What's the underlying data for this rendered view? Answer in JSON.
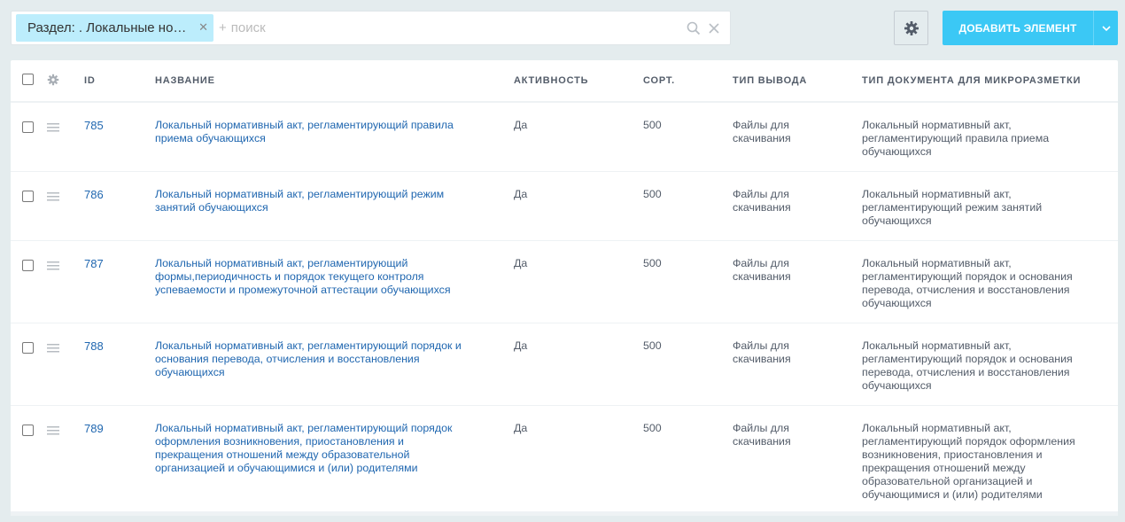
{
  "filter": {
    "chip_label": "Раздел: . Локальные но…",
    "plus": "+",
    "search_placeholder": "поиск"
  },
  "toolbar": {
    "add_label": "ДОБАВИТЬ ЭЛЕМЕНТ"
  },
  "table": {
    "headers": {
      "id": "ID",
      "name": "НАЗВАНИЕ",
      "active": "АКТИВНОСТЬ",
      "sort": "СОРТ.",
      "type": "ТИП ВЫВОДА",
      "doctype": "ТИП ДОКУМЕНТА ДЛЯ МИКРОРАЗМЕТКИ"
    },
    "rows": [
      {
        "id": "785",
        "name": "Локальный нормативный акт, регламентирующий правила приема обучающихся",
        "active": "Да",
        "sort": "500",
        "type": "Файлы для скачивания",
        "doctype": "Локальный нормативный акт, регламентирующий правила приема обучающихся"
      },
      {
        "id": "786",
        "name": "Локальный нормативный акт, регламентирующий режим занятий обучающихся",
        "active": "Да",
        "sort": "500",
        "type": "Файлы для скачивания",
        "doctype": "Локальный нормативный акт, регламентирующий режим занятий обучающихся"
      },
      {
        "id": "787",
        "name": "Локальный нормативный акт, регламентирующий формы,периодичность и порядок текущего контроля успеваемости и промежуточной аттестации обучающихся",
        "active": "Да",
        "sort": "500",
        "type": "Файлы для скачивания",
        "doctype": "Локальный нормативный акт, регламентирующий порядок и основания перевода, отчисления и восстановления обучающихся"
      },
      {
        "id": "788",
        "name": "Локальный нормативный акт, регламентирующий порядок и основания перевода, отчисления и восстановления обучающихся",
        "active": "Да",
        "sort": "500",
        "type": "Файлы для скачивания",
        "doctype": "Локальный нормативный акт, регламентирующий порядок и основания перевода, отчисления и восстановления обучающихся"
      },
      {
        "id": "789",
        "name": "Локальный нормативный акт, регламентирующий порядок оформления возникновения, приостановления и прекращения отношений между образовательной организацией и обучающимися и (или) родителями",
        "active": "Да",
        "sort": "500",
        "type": "Файлы для скачивания",
        "doctype": "Локальный нормативный акт, регламентирующий порядок оформления возникновения, приостановления и прекращения отношений между образовательной организацией и обучающимися и (или) родителями"
      }
    ]
  },
  "colors": {
    "background": "#e4ecee",
    "accent": "#3bc8f5",
    "chip": "#bcedfc",
    "link": "#2067b0"
  },
  "icons": {
    "chip_close": "close-icon",
    "search": "search-icon",
    "clear": "close-icon",
    "settings": "gear-icon",
    "add_dropdown": "chevron-down-icon",
    "row_drag": "drag-handle-icon"
  }
}
